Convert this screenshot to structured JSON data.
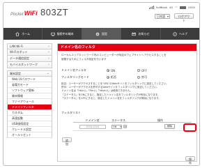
{
  "header": {
    "brand_prefix": "Pocket",
    "brand_wifi": "WiFi",
    "model": "803ZT",
    "carrier": "SoftBank",
    "network": "4G",
    "battery": "100%",
    "language": "日本語",
    "logout_label": "ログアウト"
  },
  "nav": {
    "tabs": [
      {
        "label": "ホーム",
        "icon": "home-icon"
      },
      {
        "label": "接続中の端末",
        "icon": "devices-icon"
      },
      {
        "label": "設定",
        "icon": "gear-icon"
      },
      {
        "label": "お知らせ",
        "icon": "mail-icon"
      },
      {
        "label": "ヘルプ",
        "icon": "help-icon"
      }
    ]
  },
  "sidebar": {
    "items": [
      "LAN Wi-Fi",
      "Wi-Fiスポット",
      "データ通信設定",
      "モバイルネットワーク"
    ],
    "security_header": "端末設定",
    "sub_items": [
      "Web UIパスワード",
      "省電力モード",
      "ソフトウェア更新",
      "端末情報",
      "ファイアウォール",
      "ドメインフィルタ",
      "カスタム",
      "高速起動",
      "USB接続設定",
      "クレードル設定",
      "オールリセット"
    ],
    "selected_index": 5
  },
  "panel": {
    "title": "ドメイン名のフィルタ",
    "description_1": "ローカルエリアネットワーク内のコンピューターが特定のウェブサイトへアクセスすることを",
    "description_2": "制限するためにフィルタ設定を行います",
    "filter_label": "ドメイン名フィルタ",
    "filter_on": "ON",
    "filter_off": "OFF",
    "mode_label": "フィルタリングモード",
    "mode_deny": "拒否",
    "mode_allow": "許可",
    "note_1": "拒否：ユーザーがアクセスすることを\"URL\"のWebサイトをフィルタリングに設定してください。",
    "note_2": "許可：ユーザーがアクセスを許可するWebサイトをフィルタリングに設定してください。",
    "note_3": "ドメイン名は「http://」「file://」「https://」は使用できません。",
    "note_4": "「ステータス」をONにすると、指定したドメイン名をフィルタリングが有効になります。",
    "note_5": "「ステータス」をOFFにすると、設定したドメイン名をフィルタリングが無効になります。",
    "list_label": "フィルタリスト",
    "col_domain": "ドメイン名",
    "col_status": "ステータス",
    "col_action": "操作",
    "row_domain": "1234.1234",
    "row_status": "ON",
    "add_symbol": "+",
    "delete_label": "削除",
    "apply_label": "追加",
    "save_label": "保存"
  }
}
